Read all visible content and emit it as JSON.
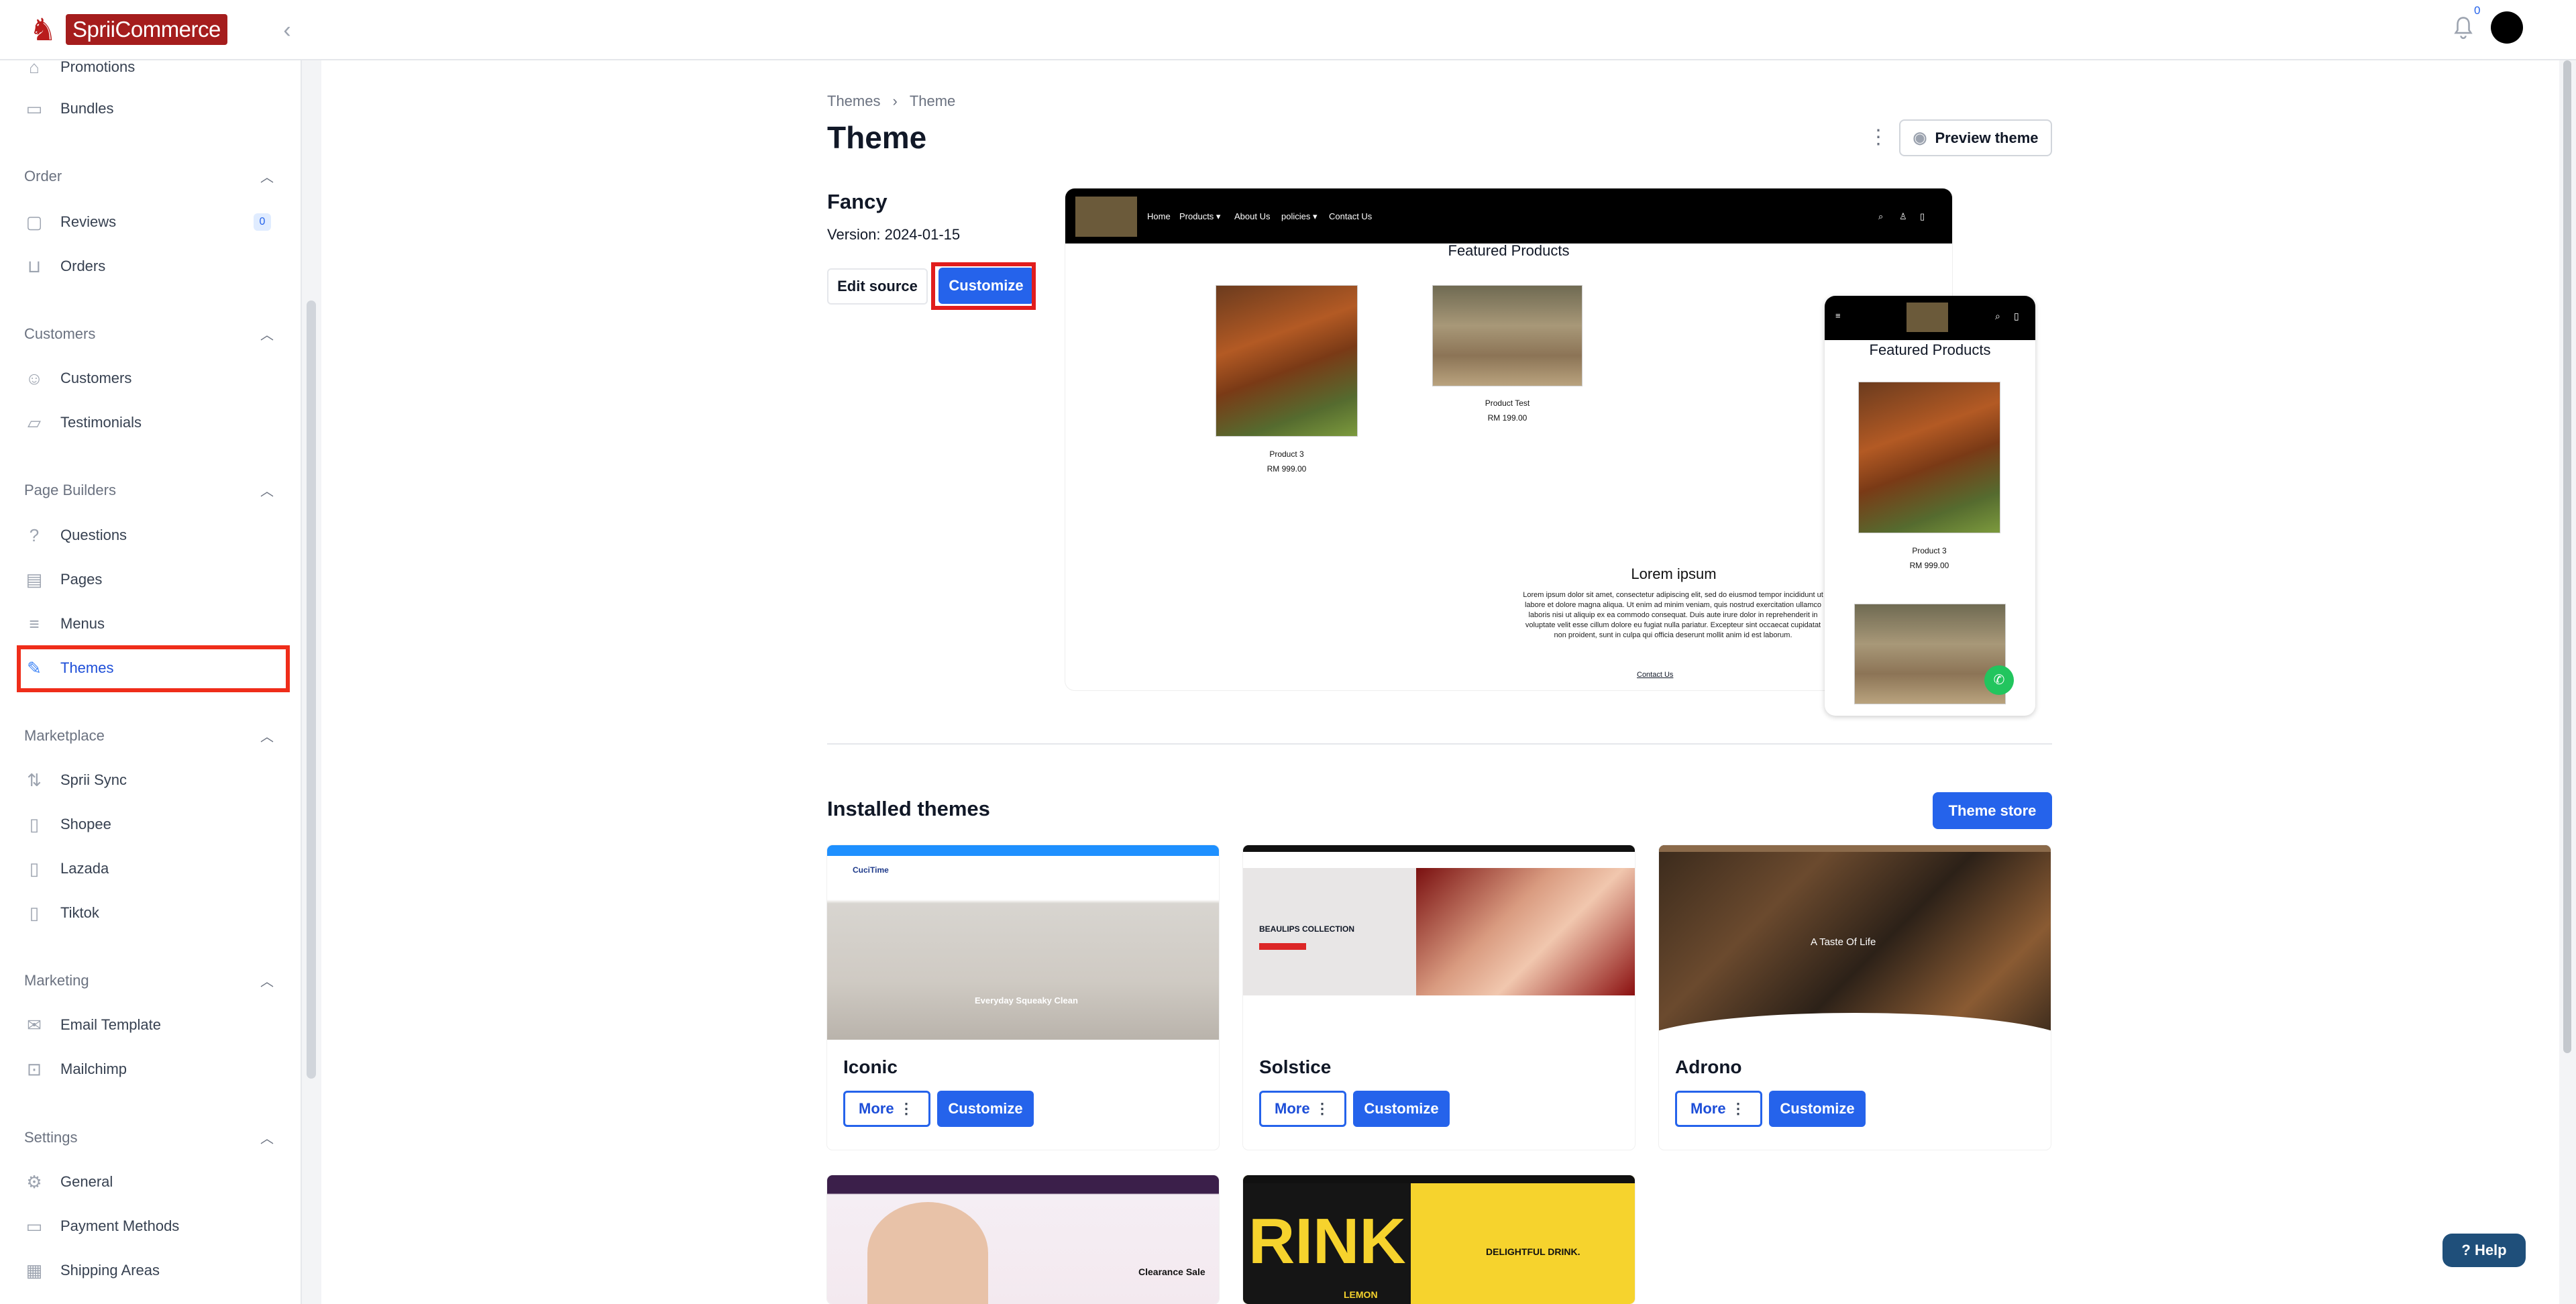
{
  "brand": {
    "name": "SpriiCommerce"
  },
  "topbar": {
    "notification_count": "0"
  },
  "sidebar": {
    "sections": [
      {
        "title": "Order"
      },
      {
        "title": "Customers"
      },
      {
        "title": "Page Builders"
      },
      {
        "title": "Marketplace"
      },
      {
        "title": "Marketing"
      },
      {
        "title": "Settings"
      }
    ],
    "items": {
      "promotions": "Promotions",
      "bundles": "Bundles",
      "reviews": "Reviews",
      "reviews_count": "0",
      "orders": "Orders",
      "customers": "Customers",
      "testimonials": "Testimonials",
      "questions": "Questions",
      "pages": "Pages",
      "menus": "Menus",
      "themes": "Themes",
      "sprii_sync": "Sprii Sync",
      "shopee": "Shopee",
      "lazada": "Lazada",
      "tiktok": "Tiktok",
      "email_template": "Email Template",
      "mailchimp": "Mailchimp",
      "general": "General",
      "payment_methods": "Payment Methods",
      "shipping_areas": "Shipping Areas"
    }
  },
  "breadcrumb": {
    "parent": "Themes",
    "current": "Theme"
  },
  "page": {
    "title": "Theme",
    "preview_label": "Preview theme"
  },
  "current_theme": {
    "name": "Fancy",
    "version": "Version: 2024-01-15",
    "edit_source_label": "Edit source",
    "customize_label": "Customize"
  },
  "preview": {
    "nav": [
      "Home",
      "Products ▾",
      "About Us",
      "policies ▾",
      "Contact Us"
    ],
    "featured_title": "Featured Products",
    "products": [
      {
        "name": "Product 3",
        "price": "RM 999.00"
      },
      {
        "name": "Product Test",
        "price": "RM 199.00"
      }
    ],
    "lorem_title": "Lorem ipsum",
    "lorem_text": "Lorem ipsum dolor sit amet, consectetur adipiscing elit, sed do eiusmod tempor incididunt ut labore et dolore magna aliqua. Ut enim ad minim veniam, quis nostrud exercitation ullamco laboris nisi ut aliquip ex ea commodo consequat. Duis aute irure dolor in reprehenderit in voluptate velit esse cillum dolore eu fugiat nulla pariatur. Excepteur sint occaecat cupidatat non proident, sunt in culpa qui officia deserunt mollit anim id est laborum.",
    "contact_link": "Contact Us",
    "mobile_featured_title": "Featured Products",
    "mobile_product": {
      "name": "Product 3",
      "price": "RM 999.00"
    }
  },
  "installed": {
    "title": "Installed themes",
    "store_label": "Theme store",
    "more_label": "More",
    "customize_label": "Customize",
    "themes": [
      {
        "name": "Iconic",
        "thumb_text": "Everyday Squeaky Clean",
        "thumb_logo": "CuciTime"
      },
      {
        "name": "Solstice",
        "thumb_text": "BEAULIPS COLLECTION"
      },
      {
        "name": "Adrono",
        "thumb_text": "A Taste Of Life"
      }
    ],
    "partial_thumbs": [
      {
        "thumb_text": "Clearance Sale"
      },
      {
        "thumb_text": "DELIGHTFUL DRINK.",
        "thumb_big": "RINK",
        "thumb_small": "LEMON"
      }
    ]
  },
  "help": {
    "label": "Help"
  }
}
